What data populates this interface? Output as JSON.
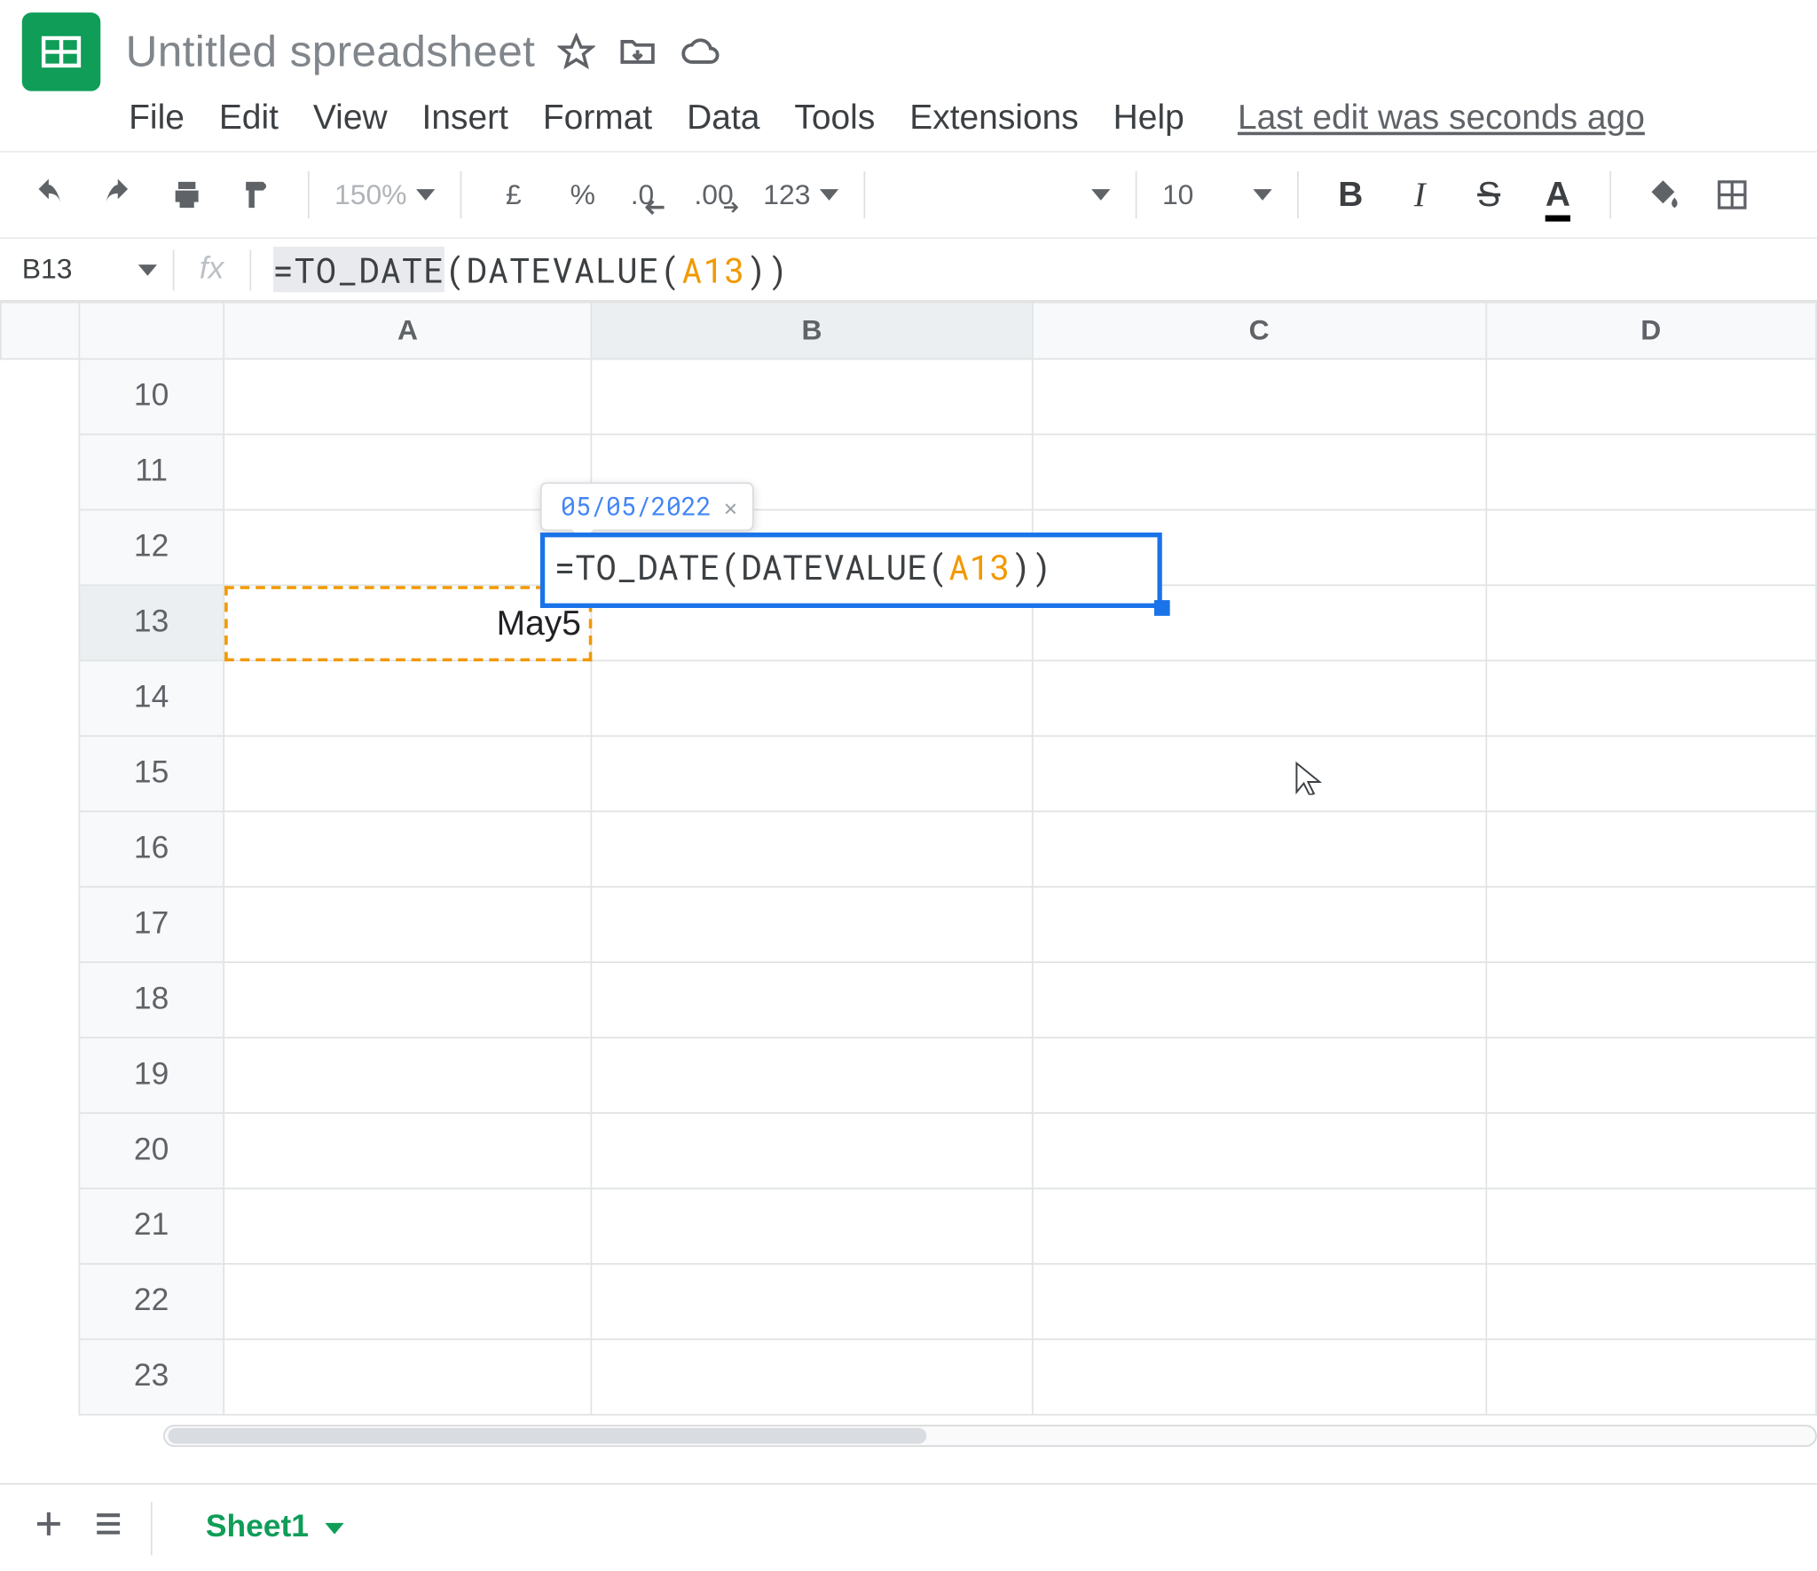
{
  "doc": {
    "title": "Untitled spreadsheet"
  },
  "menus": {
    "file": "File",
    "edit": "Edit",
    "view": "View",
    "insert": "Insert",
    "format": "Format",
    "data": "Data",
    "tools": "Tools",
    "extensions": "Extensions",
    "help": "Help"
  },
  "last_edit": "Last edit was seconds ago",
  "toolbar": {
    "zoom": "150%",
    "currency": "£",
    "percent": "%",
    "dec_less": ".0",
    "dec_more": ".00",
    "format_menu": "123",
    "font_size": "10"
  },
  "name_box": "B13",
  "formula_bar": {
    "prefix": "=TO_DATE",
    "open": "(",
    "fn2": "DATEVALUE",
    "open2": "(",
    "ref": "A13",
    "close2": ")",
    "close": ")"
  },
  "columns": [
    "A",
    "B",
    "C",
    "D"
  ],
  "rows": [
    "10",
    "11",
    "12",
    "13",
    "14",
    "15",
    "16",
    "17",
    "18",
    "19",
    "20",
    "21",
    "22",
    "23"
  ],
  "selected_col_index": 1,
  "selected_row_index": 3,
  "cells": {
    "A13": "May5"
  },
  "editor": {
    "result_preview": "05/05/2022",
    "content": {
      "prefix": "=TO_DATE",
      "open": "(",
      "fn2": "DATEVALUE",
      "open2": "(",
      "ref": "A13",
      "close2": ")",
      "close": ")"
    }
  },
  "sheet_tab": "Sheet1"
}
